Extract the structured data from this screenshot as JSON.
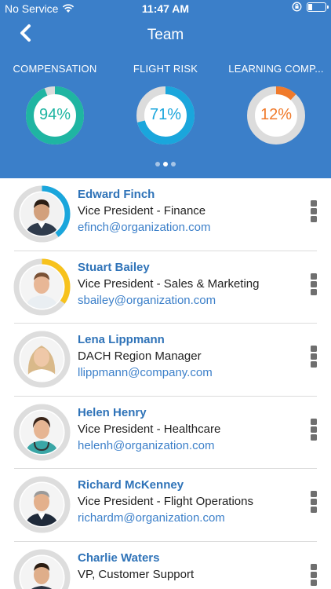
{
  "status_bar": {
    "carrier": "No Service",
    "time": "11:47 AM"
  },
  "nav": {
    "title": "Team"
  },
  "metrics": [
    {
      "label": "COMPENSATION",
      "value": "94%",
      "percent": 94,
      "color": "#1fb5a2"
    },
    {
      "label": "FLIGHT RISK",
      "value": "71%",
      "percent": 71,
      "color": "#1aa6dc"
    },
    {
      "label": "LEARNING COMP...",
      "value": "12%",
      "percent": 12,
      "color": "#f07a2b"
    }
  ],
  "pager": {
    "pages": 3,
    "active": 1
  },
  "people": [
    {
      "name": "Edward Finch",
      "role": "Vice President - Finance",
      "email": "efinch@organization.com",
      "ring_percent": 40,
      "ring_color": "#1aa6dc"
    },
    {
      "name": "Stuart Bailey",
      "role": "Vice President - Sales & Marketing",
      "email": "sbailey@organization.com",
      "ring_percent": 35,
      "ring_color": "#f7c21c"
    },
    {
      "name": "Lena Lippmann",
      "role": "DACH Region Manager",
      "email": "llippmann@company.com",
      "ring_percent": 0,
      "ring_color": "#cccccc"
    },
    {
      "name": "Helen Henry",
      "role": "Vice President - Healthcare",
      "email": "helenh@organization.com",
      "ring_percent": 0,
      "ring_color": "#cccccc"
    },
    {
      "name": "Richard McKenney",
      "role": "Vice President - Flight Operations",
      "email": "richardm@organization.com",
      "ring_percent": 0,
      "ring_color": "#cccccc"
    },
    {
      "name": "Charlie Waters",
      "role": "VP, Customer Support",
      "email": "",
      "ring_percent": 0,
      "ring_color": "#cccccc"
    }
  ]
}
